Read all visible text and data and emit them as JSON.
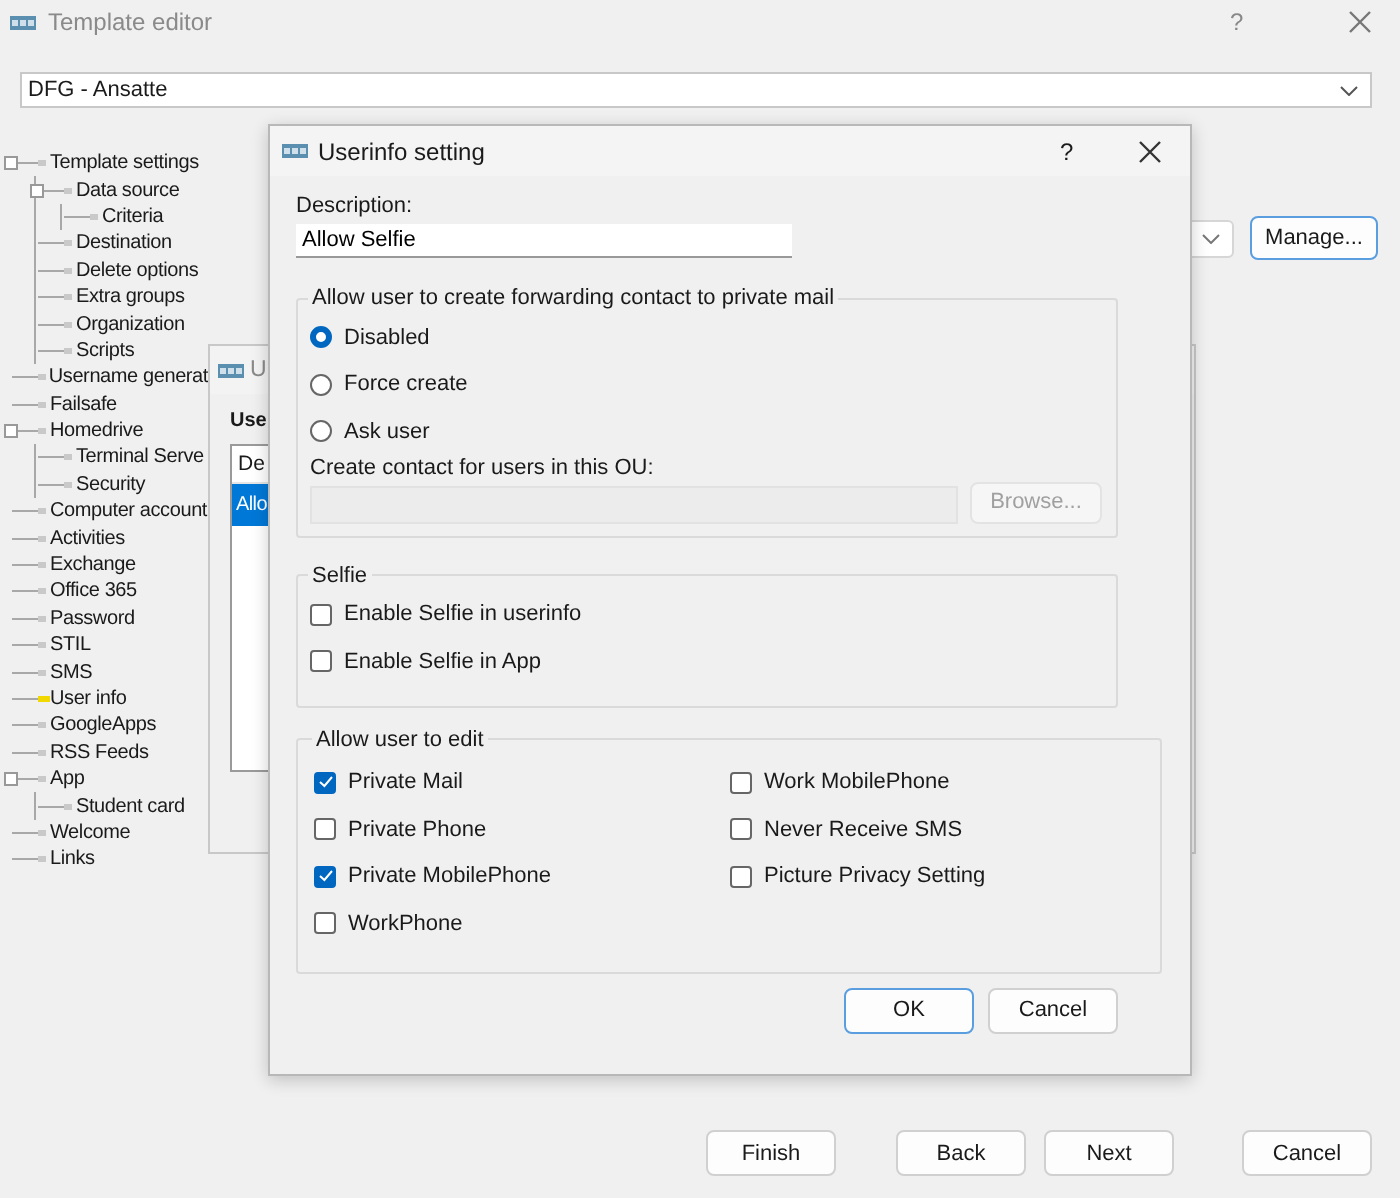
{
  "window": {
    "title": "Template editor",
    "help": "?"
  },
  "template_select": {
    "value": "DFG - Ansatte"
  },
  "tree": [
    {
      "label": "Template settings",
      "selected": false,
      "children": [
        {
          "label": "Data source",
          "selected": false,
          "children": [
            {
              "label": "Criteria",
              "selected": false
            }
          ]
        },
        {
          "label": "Destination",
          "selected": false
        },
        {
          "label": "Delete options",
          "selected": false
        },
        {
          "label": "Extra groups",
          "selected": false
        },
        {
          "label": "Organization",
          "selected": false
        },
        {
          "label": "Scripts",
          "selected": false
        }
      ]
    },
    {
      "label": "Username generat",
      "selected": false
    },
    {
      "label": "Failsafe",
      "selected": false
    },
    {
      "label": "Homedrive",
      "selected": false,
      "children": [
        {
          "label": "Terminal Serve",
          "selected": false
        },
        {
          "label": "Security",
          "selected": false
        }
      ]
    },
    {
      "label": "Computer account",
      "selected": false
    },
    {
      "label": "Activities",
      "selected": false
    },
    {
      "label": "Exchange",
      "selected": false
    },
    {
      "label": "Office 365",
      "selected": false
    },
    {
      "label": "Password",
      "selected": false
    },
    {
      "label": "STIL",
      "selected": false
    },
    {
      "label": "SMS",
      "selected": false
    },
    {
      "label": "User info",
      "selected": true
    },
    {
      "label": "GoogleApps",
      "selected": false
    },
    {
      "label": "RSS Feeds",
      "selected": false
    },
    {
      "label": "App",
      "selected": false,
      "children": [
        {
          "label": "Student card",
          "selected": false
        }
      ]
    },
    {
      "label": "Welcome",
      "selected": false
    },
    {
      "label": "Links",
      "selected": false
    }
  ],
  "manage_button": {
    "label": "Manage...",
    "focused": true
  },
  "footer_buttons": [
    {
      "label": "Finish"
    },
    {
      "label": "Back"
    },
    {
      "label": "Next"
    },
    {
      "label": "Cancel"
    }
  ],
  "background_dialog": {
    "title": "U",
    "section_label": "Use",
    "columns": [
      "De"
    ],
    "rows": [
      {
        "cells": [
          "Allo"
        ],
        "selected": true
      }
    ]
  },
  "dialog": {
    "title": "Userinfo setting",
    "help": "?",
    "description_label": "Description:",
    "description_value": "Allow Selfie",
    "forwarding": {
      "legend": "Allow user to create forwarding contact to private mail",
      "options": [
        {
          "label": "Disabled",
          "selected": true
        },
        {
          "label": "Force create",
          "selected": false
        },
        {
          "label": "Ask user",
          "selected": false
        }
      ],
      "ou_label": "Create contact for users in this OU:",
      "ou_field_disabled": true,
      "browse_button": {
        "label": "Browse...",
        "disabled": true
      }
    },
    "selfie": {
      "legend": "Selfie",
      "options": [
        {
          "label": "Enable Selfie in userinfo",
          "checked": false
        },
        {
          "label": "Enable Selfie in App",
          "checked": false
        }
      ]
    },
    "edit": {
      "legend": "Allow user to edit",
      "columns": [
        [
          {
            "label": "Private Mail",
            "checked": true
          },
          {
            "label": "Private Phone",
            "checked": false
          },
          {
            "label": "Private MobilePhone",
            "checked": true
          },
          {
            "label": "WorkPhone",
            "checked": false
          }
        ],
        [
          {
            "label": "Work MobilePhone",
            "checked": false
          },
          {
            "label": "Never Receive SMS",
            "checked": false
          },
          {
            "label": "Picture Privacy Setting",
            "checked": false
          }
        ]
      ]
    },
    "buttons": [
      {
        "label": "OK",
        "default": true
      },
      {
        "label": "Cancel",
        "default": false
      }
    ]
  }
}
